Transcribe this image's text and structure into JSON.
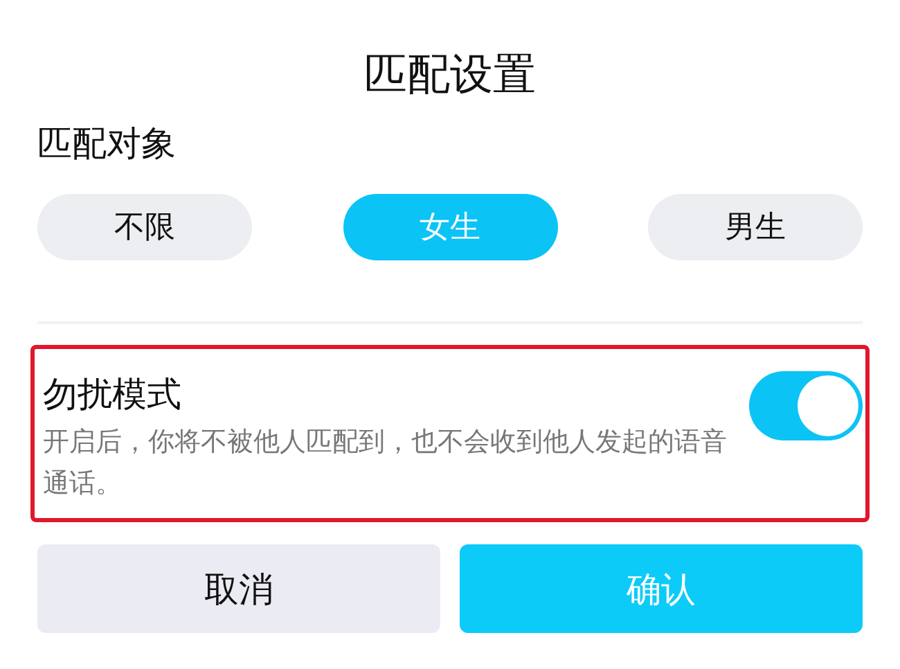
{
  "title": "匹配设置",
  "section_label": "匹配对象",
  "options": [
    {
      "label": "不限",
      "selected": false
    },
    {
      "label": "女生",
      "selected": true
    },
    {
      "label": "男生",
      "selected": false
    }
  ],
  "do_not_disturb": {
    "title": "勿扰模式",
    "description": "开启后，你将不被他人匹配到，也不会收到他人发起的语音通话。",
    "on": true,
    "highlighted": true
  },
  "buttons": [
    {
      "label": "取消",
      "kind": "secondary"
    },
    {
      "label": "确认",
      "kind": "primary"
    }
  ]
}
